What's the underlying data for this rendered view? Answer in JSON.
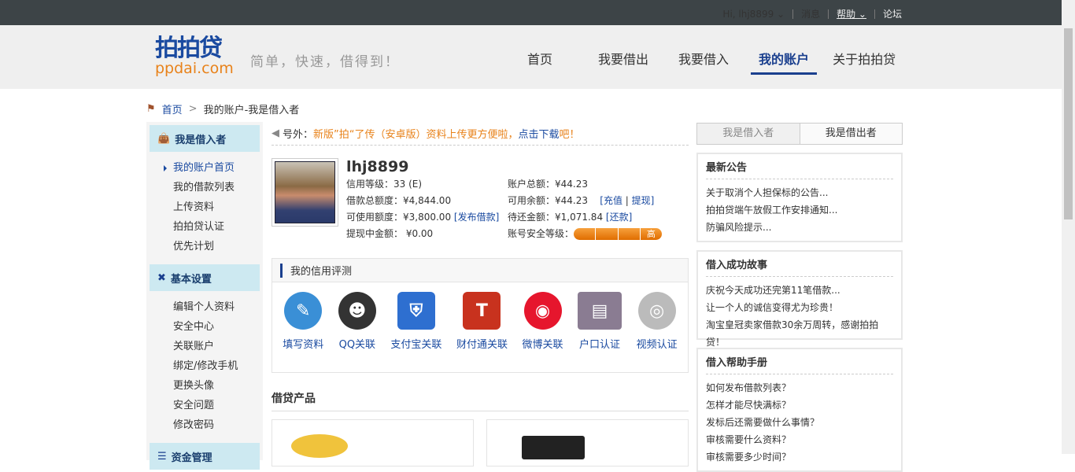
{
  "topbar": {
    "greeting": "Hi, lhj8899 ⌄",
    "messages": "消息",
    "help": "帮助 ⌄",
    "forum": "论坛"
  },
  "logo": {
    "cn": "拍拍贷",
    "en": "ppdai.com"
  },
  "slogan": "简单，快速，借得到！",
  "nav": [
    "首页",
    "我要借出",
    "我要借入",
    "我的账户",
    "关于拍拍贷"
  ],
  "breadcrumb": {
    "home": "首页",
    "sep": ">",
    "current": "我的账户-我是借入者"
  },
  "sidebar": [
    {
      "title": "我是借入者",
      "items": [
        "我的账户首页",
        "我的借款列表",
        "上传资料",
        "拍拍贷认证",
        "优先计划"
      ]
    },
    {
      "title": "基本设置",
      "items": [
        "编辑个人资料",
        "安全中心",
        "关联账户",
        "绑定/修改手机",
        "更换头像",
        "安全问题",
        "修改密码"
      ]
    },
    {
      "title": "资金管理",
      "items": []
    }
  ],
  "notice": {
    "prefix": "号外：",
    "text": "新版”拍“了传（安卓版）资料上传更方便啦，",
    "link": "点击下载",
    "suffix": "吧！"
  },
  "profile": {
    "name": "lhj8899",
    "credit_level": "信用等级：33 (E)",
    "account_total": "账户总额：¥44.23",
    "loan_total": "借款总额度：¥4,844.00",
    "available": "可用余额：¥44.23",
    "recharge": "[充值",
    "withdraw_link": "提现]",
    "usable": "可使用额度：¥3,800.00",
    "publish": "[发布借款]",
    "pending": "待还金额：¥1,071.84",
    "repay": "[还款]",
    "withdrawing": "提现中金额： ¥0.00",
    "security": "账号安全等级：",
    "security_level": "高",
    "security_fraction": 1.0
  },
  "credit": {
    "title": "我的信用评测",
    "items": [
      "填写资料",
      "QQ关联",
      "支付宝关联",
      "财付通关联",
      "微博关联",
      "户口认证",
      "视频认证"
    ]
  },
  "products": {
    "title": "借贷产品"
  },
  "right": {
    "tabs": [
      "我是借入者",
      "我是借出者"
    ],
    "boxes": [
      {
        "title": "最新公告",
        "items": [
          "关于取消个人担保标的公告...",
          "拍拍贷端午放假工作安排通知...",
          "防骗风险提示..."
        ]
      },
      {
        "title": "借入成功故事",
        "items": [
          "庆祝今天成功还完第11笔借款...",
          "让一个人的诚信变得尤为珍贵！",
          "淘宝皇冠卖家借款30余万周转，感谢拍拍贷！"
        ]
      },
      {
        "title": "借入帮助手册",
        "items": [
          "如何发布借款列表？",
          "怎样才能尽快满标？",
          "发标后还需要做什么事情？",
          "审核需要什么资料？",
          "审核需要多少时间？"
        ]
      }
    ]
  }
}
